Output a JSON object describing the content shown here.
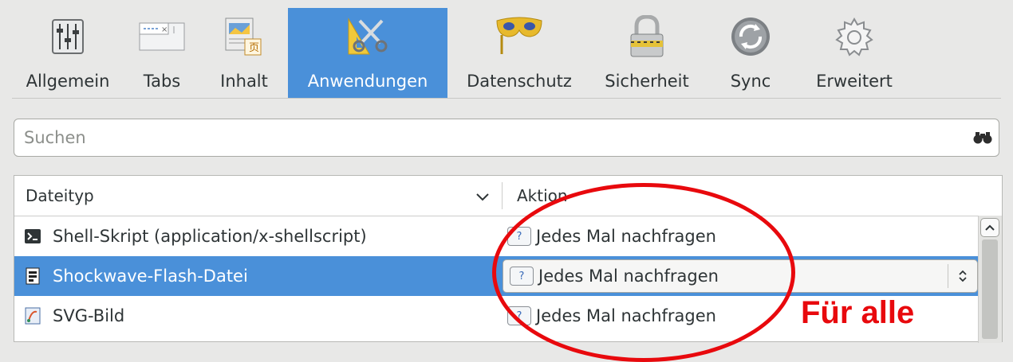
{
  "toolbar": {
    "items": [
      {
        "label": "Allgemein",
        "icon": "sliders-icon"
      },
      {
        "label": "Tabs",
        "icon": "tabs-icon"
      },
      {
        "label": "Inhalt",
        "icon": "content-icon"
      },
      {
        "label": "Anwendungen",
        "icon": "applications-icon",
        "active": true
      },
      {
        "label": "Datenschutz",
        "icon": "mask-icon"
      },
      {
        "label": "Sicherheit",
        "icon": "padlock-icon"
      },
      {
        "label": "Sync",
        "icon": "sync-icon"
      },
      {
        "label": "Erweitert",
        "icon": "gear-icon"
      }
    ]
  },
  "search": {
    "placeholder": "Suchen"
  },
  "table": {
    "headers": {
      "file_type": "Dateityp",
      "action": "Aktion"
    },
    "rows": [
      {
        "type": "Shell-Skript (application/x-shellscript)",
        "action": "Jedes Mal nachfragen"
      },
      {
        "type": "Shockwave-Flash-Datei",
        "action": "Jedes Mal nachfragen",
        "selected": true
      },
      {
        "type": "SVG-Bild",
        "action": "Jedes Mal nachfragen"
      }
    ]
  },
  "annotation": {
    "text": "Für alle",
    "color": "#e8090d"
  },
  "colors": {
    "accent": "#4a90d9",
    "background": "#e8e8e7"
  }
}
